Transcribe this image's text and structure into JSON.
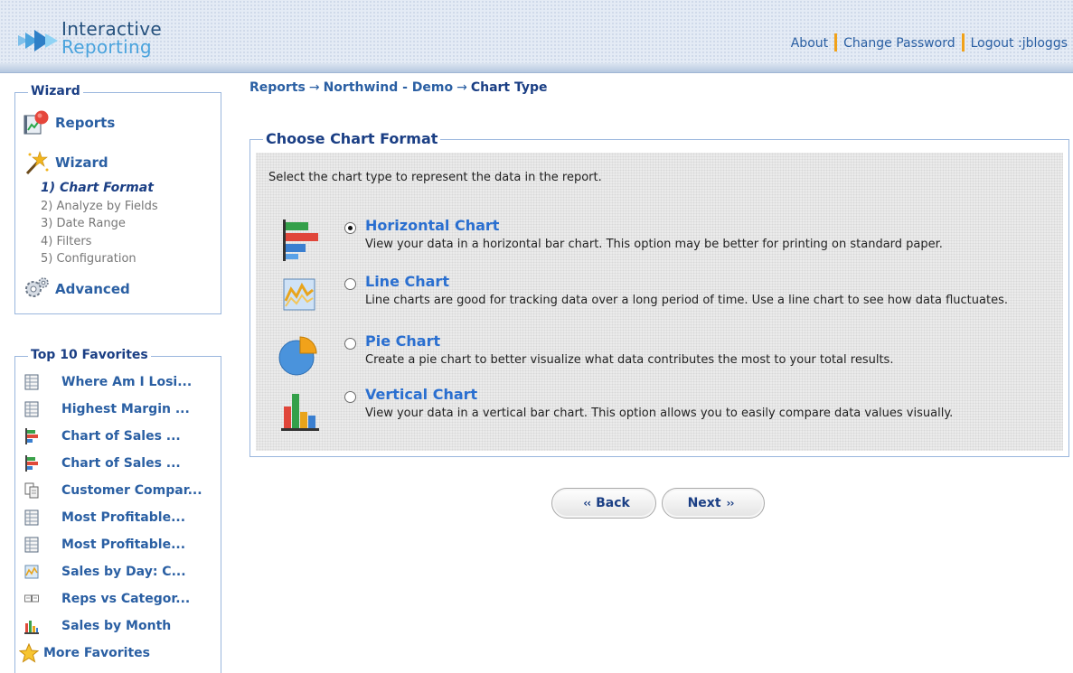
{
  "header": {
    "logo_line1": "Interactive",
    "logo_line2": "Reporting",
    "nav": {
      "about": "About",
      "change_password": "Change Password",
      "logout": "Logout :jbloggs"
    }
  },
  "wizard_panel": {
    "title": "Wizard",
    "reports_label": "Reports",
    "wizard_label": "Wizard",
    "steps": [
      "1) Chart Format",
      "2) Analyze by Fields",
      "3) Date Range",
      "4) Filters",
      "5) Configuration"
    ],
    "advanced_label": "Advanced"
  },
  "favorites_panel": {
    "title": "Top 10 Favorites",
    "items": [
      {
        "label": "Where Am I Losi...",
        "icon": "table-report-icon"
      },
      {
        "label": "Highest Margin ...",
        "icon": "table-report-icon"
      },
      {
        "label": "Chart of Sales ...",
        "icon": "horizontal-chart-icon"
      },
      {
        "label": "Chart of Sales ...",
        "icon": "horizontal-chart-icon"
      },
      {
        "label": "Customer Compar...",
        "icon": "document-compare-icon"
      },
      {
        "label": "Most Profitable...",
        "icon": "table-report-icon"
      },
      {
        "label": "Most Profitable...",
        "icon": "table-report-icon"
      },
      {
        "label": "Sales by Day: C...",
        "icon": "line-chart-icon"
      },
      {
        "label": "Reps vs Categor...",
        "icon": "crosstab-icon"
      },
      {
        "label": "Sales by Month",
        "icon": "vertical-chart-icon"
      }
    ],
    "more_label": "More Favorites"
  },
  "breadcrumb": {
    "reports": "Reports",
    "arrow": "→",
    "northwind": "Northwind - Demo",
    "current": "Chart Type"
  },
  "chart_format": {
    "title": "Choose Chart Format",
    "instruction": "Select the chart type to represent the data in the report.",
    "selected": "horizontal",
    "options": [
      {
        "id": "horizontal",
        "title": "Horizontal Chart",
        "description": "View your data in a horizontal bar chart. This option may be better for printing on standard paper.",
        "icon": "horizontal-bar-chart-icon"
      },
      {
        "id": "line",
        "title": "Line Chart",
        "description": "Line charts are good for tracking data over a long period of time. Use a line chart to see how data fluctuates.",
        "icon": "line-chart-icon"
      },
      {
        "id": "pie",
        "title": "Pie Chart",
        "description": "Create a pie chart to better visualize what data contributes the most to your total results.",
        "icon": "pie-chart-icon"
      },
      {
        "id": "vertical",
        "title": "Vertical Chart",
        "description": "View your data in a vertical bar chart. This option allows you to easily compare data values visually.",
        "icon": "vertical-bar-chart-icon"
      }
    ]
  },
  "buttons": {
    "back": "Back",
    "next": "Next",
    "back_chevron": "‹‹",
    "next_chevron": "››"
  },
  "colors": {
    "link": "#2a5fa3",
    "heading": "#1a3e84",
    "option_title": "#2a6fd0",
    "separator": "#f1a21a"
  }
}
